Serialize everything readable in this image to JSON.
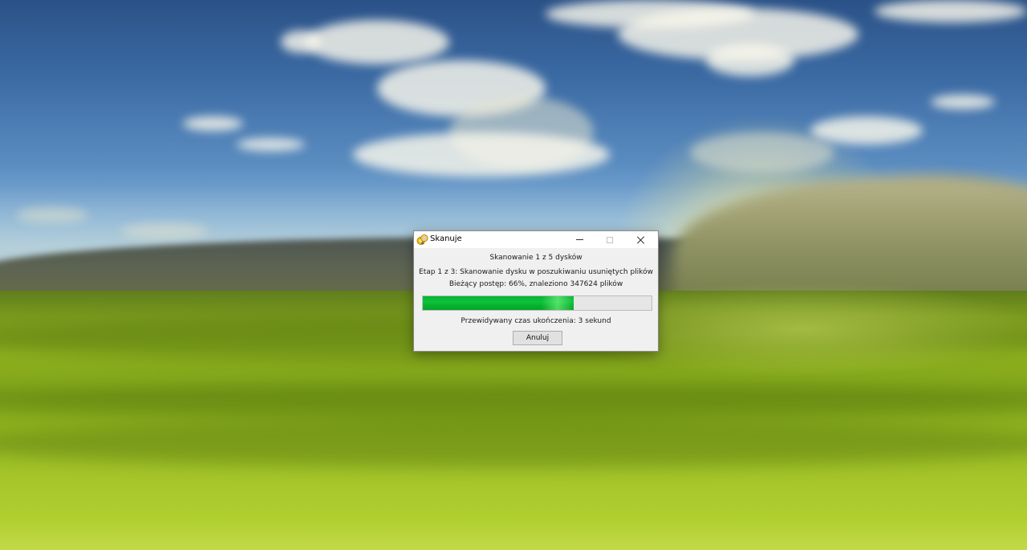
{
  "desktop": {
    "wallpaper": "grassy-field-sunset-sky"
  },
  "dialog": {
    "title": "Skanuje",
    "icon": "scan-app-icon",
    "title_buttons": {
      "minimize": "minimize-icon",
      "maximize": "maximize-icon",
      "close": "close-icon"
    },
    "scan_status": "Skanowanie 1 z 5 dysków",
    "stage_status": "Etap 1 z 3: Skanowanie dysku w poszukiwaniu usuniętych plików",
    "current_progress": "Bieżący postęp: 66%, znaleziono 347624 plików",
    "progress_percent": 66,
    "progress_color": "#0bb535",
    "eta": "Przewidywany czas ukończenia: 3 sekund",
    "cancel_label": "Anuluj"
  }
}
